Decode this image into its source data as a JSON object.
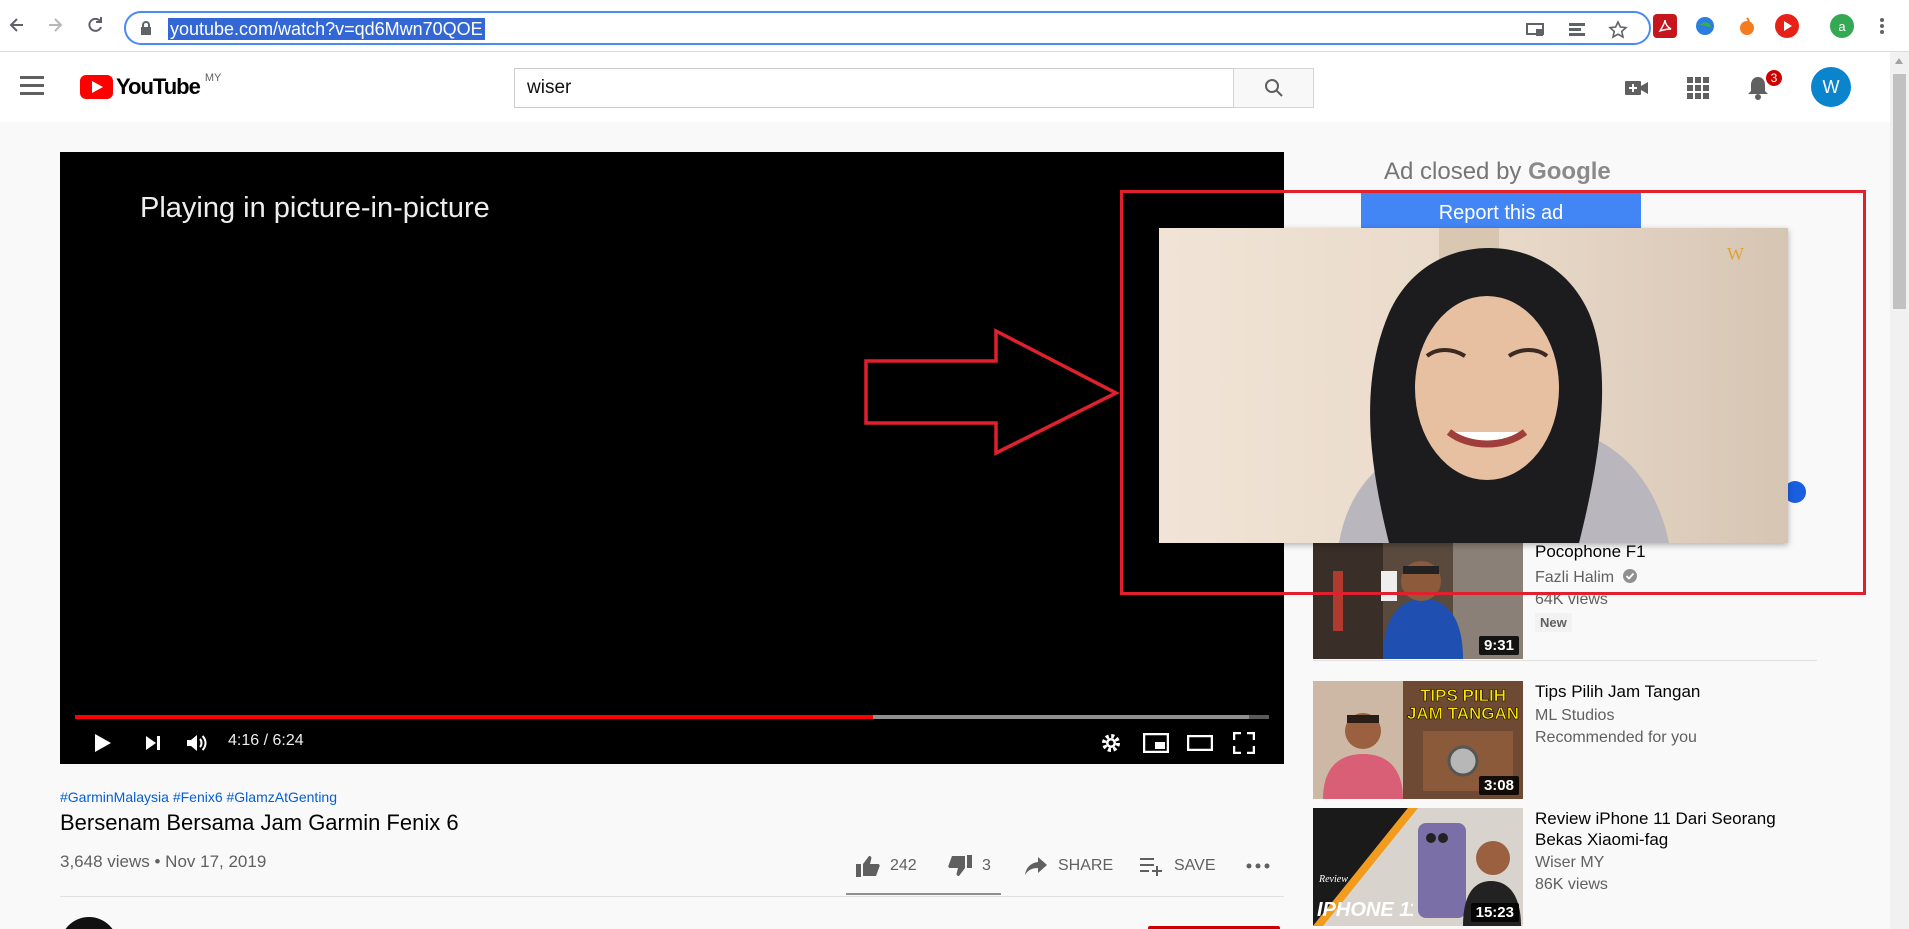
{
  "browser": {
    "url": "youtube.com/watch?v=qd6Mwn70QOE",
    "profile_initial": "a"
  },
  "header": {
    "logo_text": "YouTube",
    "region": "MY",
    "search_value": "wiser",
    "notification_count": "3",
    "avatar_initial": "W"
  },
  "player": {
    "pip_message": "Playing in picture-in-picture",
    "time": "4:16 / 6:24",
    "progress_played_fraction": 0.668,
    "progress_loaded_fraction": 0.983
  },
  "video": {
    "hashtags": "#GarminMalaysia #Fenix6 #GlamzAtGenting",
    "title": "Bersenam Bersama Jam Garmin Fenix 6",
    "views_date": "3,648 views • Nov 17, 2019",
    "likes": "242",
    "dislikes": "3",
    "share_label": "SHARE",
    "save_label": "SAVE"
  },
  "sidebar": {
    "ad_closed_prefix": "Ad closed by",
    "ad_closed_brand": "Google",
    "report_ad_label": "Report this ad",
    "recommendations": [
      {
        "title": "Pocophone F1",
        "channel": "Fazli Halim",
        "meta": "64K views",
        "badge": "New",
        "duration": "9:31"
      },
      {
        "title": "Tips Pilih Jam Tangan",
        "channel": "ML Studios",
        "meta": "Recommended for you",
        "duration": "3:08",
        "thumb_text": "TIPS PILIH JAM TANGAN"
      },
      {
        "title": "Review iPhone 11 Dari Seorang Bekas Xiaomi-fag",
        "channel": "Wiser MY",
        "meta": "86K views",
        "duration": "15:23",
        "thumb_text": "IPHONE 11",
        "thumb_small": "Review"
      }
    ]
  },
  "colors": {
    "yt_red": "#ff0000",
    "annotation_red": "#e0202c",
    "link_blue": "#065fd4",
    "report_button": "#4285f4"
  }
}
